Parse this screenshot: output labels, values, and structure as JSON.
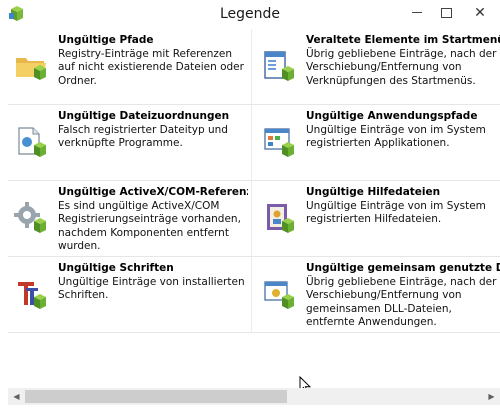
{
  "window": {
    "title": "Legende",
    "minimize_glyph": "—",
    "maximize_glyph": "☐",
    "close_glyph": "✕"
  },
  "items": [
    {
      "title": "Ungültige Pfade",
      "desc": "Registry-Einträge mit Referenzen auf nicht existierende Dateien oder Ordner.",
      "icon": "folder-icon"
    },
    {
      "title": "Veraltete Elemente im Startmenü",
      "desc": "Übrig gebliebene Einträge, nach der Verschiebung/Entfernung von Verknüpfungen des Startmenüs.",
      "icon": "start-menu-icon"
    },
    {
      "title": "Ungültige Dateizuordnungen",
      "desc": "Falsch registrierter Dateityp und verknüpfte Programme.",
      "icon": "file-association-icon"
    },
    {
      "title": "Ungültige Anwendungspfade",
      "desc": "Ungültige Einträge von im System registrierten Applikationen.",
      "icon": "application-window-icon"
    },
    {
      "title": "Ungültige ActiveX/COM-Referenzen",
      "desc": "Es sind ungültige ActiveX/COM Registrierungseinträge vorhanden, nachdem Komponenten entfernt wurden.",
      "icon": "gear-icon"
    },
    {
      "title": "Ungültige Hilfedateien",
      "desc": "Ungültige Einträge von im System registrierten Hilfedateien.",
      "icon": "help-book-icon"
    },
    {
      "title": "Ungültige Schriften",
      "desc": "Ungültige Einträge von installierten Schriften.",
      "icon": "font-icon"
    },
    {
      "title": "Ungültige gemeinsam genutzte DLLs",
      "desc": "Übrig gebliebene Einträge, nach der Verschiebung/Entfernung von gemeinsamen DLL-Dateien, entfernte Anwendungen.",
      "icon": "shared-dll-icon"
    }
  ],
  "scrollbar": {
    "left_arrow": "◀",
    "right_arrow": "▶"
  }
}
